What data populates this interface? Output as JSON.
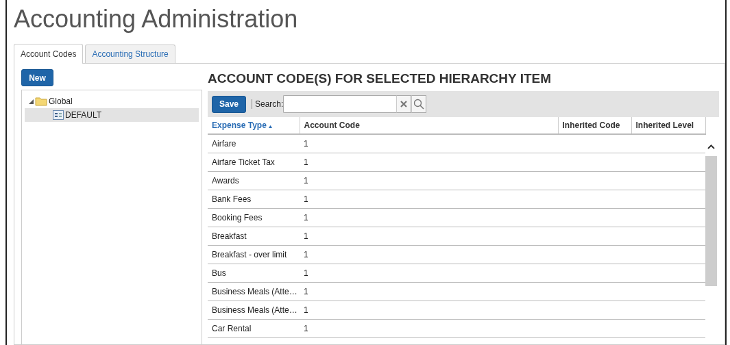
{
  "page_title": "Accounting Administration",
  "tabs": [
    {
      "label": "Account Codes",
      "selected": true
    },
    {
      "label": "Accounting Structure",
      "selected": false
    }
  ],
  "new_button": "New",
  "tree": [
    {
      "label": "Global",
      "kind": "folder",
      "expanded": true,
      "selected": false,
      "children": [
        {
          "label": "DEFAULT",
          "kind": "item",
          "selected": true
        }
      ]
    }
  ],
  "heading": "ACCOUNT CODE(S) FOR SELECTED HIERARCHY ITEM",
  "toolbar": {
    "save": "Save",
    "search_label": "Search:"
  },
  "table": {
    "columns": [
      {
        "label": "Expense Type",
        "sorted": true
      },
      {
        "label": "Account Code",
        "sorted": false
      },
      {
        "label": "Inherited Code",
        "sorted": false
      },
      {
        "label": "Inherited Level",
        "sorted": false
      }
    ],
    "rows": [
      [
        "Airfare",
        "1"
      ],
      [
        "Airfare Ticket Tax",
        "1"
      ],
      [
        "Awards",
        "1"
      ],
      [
        "Bank Fees",
        "1"
      ],
      [
        "Booking Fees",
        "1"
      ],
      [
        "Breakfast",
        "1"
      ],
      [
        "Breakfast - over limit",
        "1"
      ],
      [
        "Bus",
        "1"
      ],
      [
        "Business Meals (Atte…",
        "1"
      ],
      [
        "Business Meals (Atte…",
        "1"
      ],
      [
        "Car Rental",
        "1"
      ]
    ]
  }
}
